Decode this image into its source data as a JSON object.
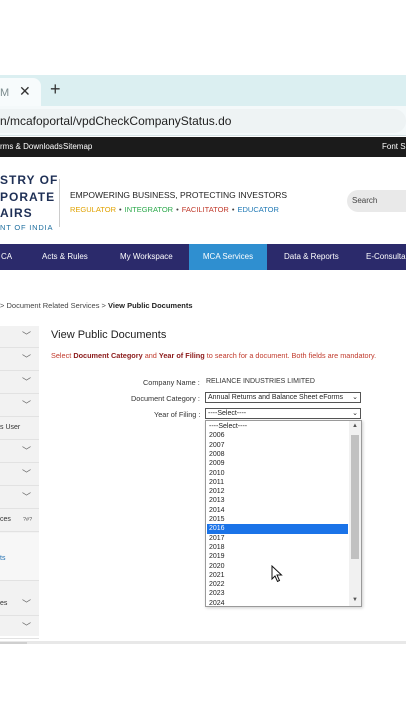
{
  "browser": {
    "tab_title": "M",
    "new_tab_symbol": "+",
    "close_symbol": "✕",
    "url": "n/mcafoportal/vpdCheckCompanyStatus.do"
  },
  "top_links": {
    "left": "rms & Downloads",
    "sitemap": "Sitemap",
    "font_size": "Font Si"
  },
  "logo": {
    "line1": "STRY OF",
    "line2": "PORATE",
    "line3": "AIRS",
    "sub": "NT OF INDIA",
    "tagline": "EMPOWERING BUSINESS, PROTECTING INVESTORS",
    "roles": [
      {
        "label": "REGULATOR",
        "color": "#e0a200"
      },
      {
        "label": "•",
        "color": "#444444"
      },
      {
        "label": "INTEGRATOR",
        "color": "#2aa84a"
      },
      {
        "label": "•",
        "color": "#444444"
      },
      {
        "label": "FACILITATOR",
        "color": "#c0392b"
      },
      {
        "label": "•",
        "color": "#444444"
      },
      {
        "label": "EDUCATOR",
        "color": "#1f78b4"
      }
    ]
  },
  "search": {
    "placeholder": "Search"
  },
  "nav": {
    "items": [
      "CA",
      "Acts & Rules",
      "My Workspace",
      "MCA Services",
      "Data & Reports",
      "E-Consulta"
    ],
    "active": "MCA Services"
  },
  "breadcrumb": {
    "prefix": ">",
    "level1": "Document Related Services",
    "sep": ">",
    "current": "View Public Documents"
  },
  "sidebar": {
    "labels": [
      "s User",
      "ces",
      "ts",
      "es"
    ],
    "small_tag": "?#?"
  },
  "main": {
    "title": "View Public Documents",
    "instruction_pre": "Select",
    "instruction_b1": "Document Category",
    "instruction_and": "and",
    "instruction_b2": "Year of Filing",
    "instruction_post": "to search for a document. Both fields are mandatory.",
    "company_label": "Company Name :",
    "company_value": "RELIANCE INDUSTRIES LIMITED",
    "category_label": "Document Category :",
    "category_value": "Annual Returns and Balance Sheet eForms",
    "year_label": "Year of Filing :",
    "year_value": "----Select----"
  },
  "dropdown": {
    "options": [
      "----Select----",
      "2006",
      "2007",
      "2008",
      "2009",
      "2010",
      "2011",
      "2012",
      "2013",
      "2014",
      "2015",
      "2016",
      "2017",
      "2018",
      "2019",
      "2020",
      "2021",
      "2022",
      "2023",
      "2024"
    ],
    "highlighted": "2016"
  },
  "colors": {
    "navbar": "#2b2a6b",
    "nav_active": "#2f8fd0",
    "highlight": "#1a73e8",
    "instruction": "#c0392b"
  }
}
